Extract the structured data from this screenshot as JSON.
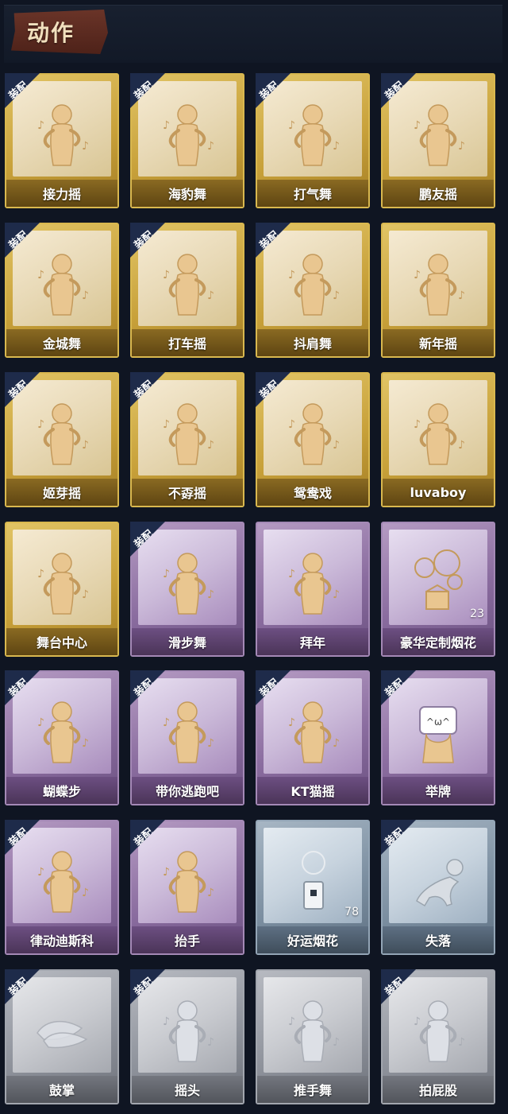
{
  "header": {
    "title": "动作"
  },
  "equip_label": "装配",
  "tiers": {
    "gold": {
      "figure": "#e9c690",
      "stroke": "#c49a5c"
    },
    "purple": {
      "figure": "#e9c690",
      "stroke": "#c49a5c"
    },
    "blue": {
      "figure": "#d8dde3",
      "stroke": "#9aa4ae"
    },
    "grey": {
      "figure": "#dde0e6",
      "stroke": "#a9adb5"
    }
  },
  "items": [
    {
      "name": "接力摇",
      "tier": "gold",
      "equipped": true,
      "icon": "dance-figure-icon"
    },
    {
      "name": "海豹舞",
      "tier": "gold",
      "equipped": true,
      "icon": "dance-figure-icon"
    },
    {
      "name": "打气舞",
      "tier": "gold",
      "equipped": true,
      "icon": "dance-figure-icon"
    },
    {
      "name": "鹏友摇",
      "tier": "gold",
      "equipped": true,
      "icon": "dance-figure-icon"
    },
    {
      "name": "金城舞",
      "tier": "gold",
      "equipped": true,
      "icon": "dance-figure-icon"
    },
    {
      "name": "打车摇",
      "tier": "gold",
      "equipped": true,
      "icon": "dance-figure-icon"
    },
    {
      "name": "抖肩舞",
      "tier": "gold",
      "equipped": true,
      "icon": "dance-figure-icon"
    },
    {
      "name": "新年摇",
      "tier": "gold",
      "equipped": false,
      "icon": "dance-figure-icon"
    },
    {
      "name": "姬芽摇",
      "tier": "gold",
      "equipped": true,
      "icon": "dance-figure-icon"
    },
    {
      "name": "不孬摇",
      "tier": "gold",
      "equipped": true,
      "icon": "dance-figure-icon"
    },
    {
      "name": "鸳鸯戏",
      "tier": "gold",
      "equipped": true,
      "icon": "dance-figure-icon"
    },
    {
      "name": "luvaboy",
      "tier": "gold",
      "equipped": false,
      "icon": "dance-figure-icon"
    },
    {
      "name": "舞台中心",
      "tier": "gold",
      "equipped": false,
      "icon": "dance-figure-icon"
    },
    {
      "name": "滑步舞",
      "tier": "purple",
      "equipped": true,
      "icon": "dance-figure-icon"
    },
    {
      "name": "拜年",
      "tier": "purple",
      "equipped": false,
      "icon": "dance-figure-icon"
    },
    {
      "name": "豪华定制烟花",
      "tier": "purple",
      "equipped": false,
      "icon": "fireworks-box-icon",
      "count": "23"
    },
    {
      "name": "蝴蝶步",
      "tier": "purple",
      "equipped": true,
      "icon": "dance-figure-icon"
    },
    {
      "name": "带你逃跑吧",
      "tier": "purple",
      "equipped": true,
      "icon": "dance-figure-icon"
    },
    {
      "name": "KT猫摇",
      "tier": "purple",
      "equipped": true,
      "icon": "dance-figure-icon"
    },
    {
      "name": "举牌",
      "tier": "purple",
      "equipped": true,
      "icon": "sign-holder-icon"
    },
    {
      "name": "律动迪斯科",
      "tier": "purple",
      "equipped": true,
      "icon": "dance-figure-icon"
    },
    {
      "name": "抬手",
      "tier": "purple",
      "equipped": true,
      "icon": "dance-figure-icon"
    },
    {
      "name": "好运烟花",
      "tier": "blue",
      "equipped": false,
      "icon": "firework-can-icon",
      "count": "78"
    },
    {
      "name": "失落",
      "tier": "blue",
      "equipped": true,
      "icon": "crawling-figure-icon"
    },
    {
      "name": "鼓掌",
      "tier": "grey",
      "equipped": true,
      "icon": "clapping-hands-icon"
    },
    {
      "name": "摇头",
      "tier": "grey",
      "equipped": true,
      "icon": "dance-figure-icon"
    },
    {
      "name": "推手舞",
      "tier": "grey",
      "equipped": false,
      "icon": "dance-figure-icon"
    },
    {
      "name": "拍屁股",
      "tier": "grey",
      "equipped": true,
      "icon": "dance-figure-icon"
    }
  ]
}
